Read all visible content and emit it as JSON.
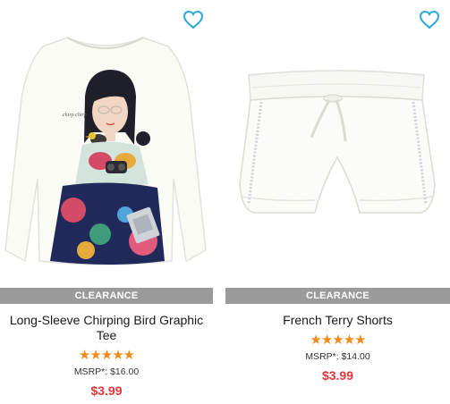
{
  "products": [
    {
      "badge": "CLEARANCE",
      "name": "Long-Sleeve Chirping Bird Graphic Tee",
      "rating": 5,
      "rating_max": 5,
      "stars": "★★★★★",
      "msrp": "MSRP*: $16.00",
      "price": "$3.99",
      "image_text": "chirp chirp"
    },
    {
      "badge": "CLEARANCE",
      "name": "French Terry Shorts",
      "rating": 5,
      "rating_max": 5,
      "stars": "★★★★★",
      "msrp": "MSRP*: $14.00",
      "price": "$3.99"
    }
  ],
  "colors": {
    "favorite_icon": "#2aa7d8",
    "badge_bg": "#9a9a9a",
    "star": "#f08c1b",
    "price": "#e3343a"
  }
}
